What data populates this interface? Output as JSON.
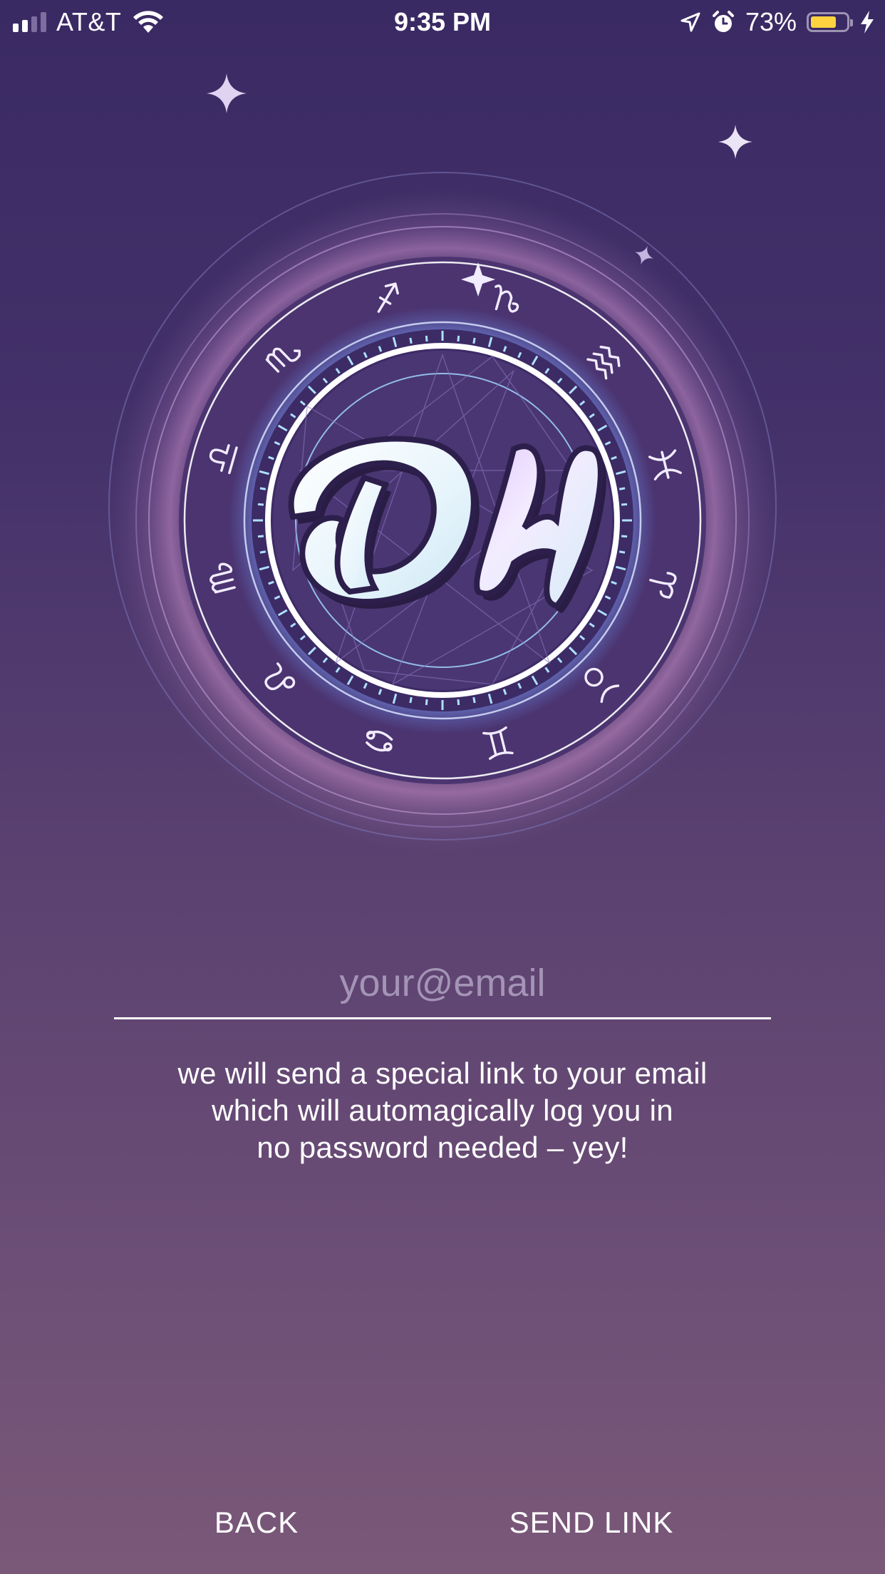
{
  "status_bar": {
    "carrier": "AT&T",
    "time": "9:35 PM",
    "battery_percent_label": "73%",
    "battery_level": 0.73,
    "signal_bars_filled": 2,
    "signal_bars_total": 4
  },
  "logo": {
    "icon": "dh-zodiac-logo-icon",
    "zodiac_icons": [
      "sagittarius",
      "capricorn",
      "aquarius",
      "pisces",
      "aries",
      "taurus",
      "gemini",
      "cancer",
      "leo",
      "virgo",
      "libra",
      "scorpio"
    ]
  },
  "login": {
    "email_placeholder": "your@email",
    "email_value": "",
    "info_lines": [
      "we will send a special link to your email",
      "which will automagically log you in",
      "no password needed – yey!"
    ]
  },
  "actions": {
    "back_label": "BACK",
    "send_label": "SEND LINK"
  },
  "colors": {
    "background_top": "#3a2a63",
    "background_bottom": "#7a5878",
    "battery": "#ffd23f",
    "glow_blue": "#7eb4ff",
    "glow_pink": "#c98ec9"
  }
}
